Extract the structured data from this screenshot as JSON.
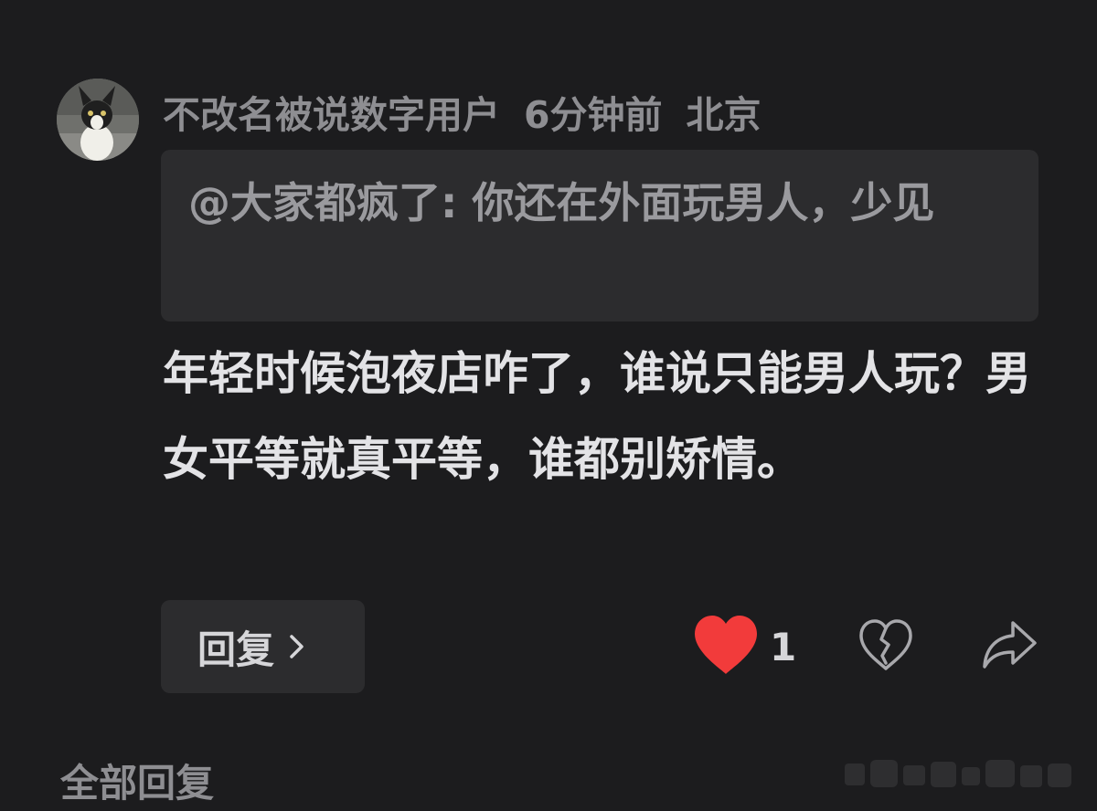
{
  "comment": {
    "avatar_icon": "cat-avatar",
    "username": "不改名被说数字用户",
    "time": "6分钟前",
    "location": "北京",
    "quote_text": "@大家都疯了: 你还在外面玩男人，少见",
    "body_text": "年轻时候泡夜店咋了，谁说只能男人玩？男女平等就真平等，谁都别矫情。",
    "reply_label": "回复",
    "reply_icon": "chevron-right-icon",
    "like_icon": "heart-icon",
    "like_count": "1",
    "like_color": "#f23b3b",
    "dislike_icon": "broken-heart-icon",
    "share_icon": "share-arrow-icon"
  },
  "all_replies_label": "全部回复",
  "colors": {
    "background": "#1c1c1e",
    "card": "#2c2c2e",
    "meta_text": "#8e8e92",
    "body_text": "#e3e3e6"
  }
}
